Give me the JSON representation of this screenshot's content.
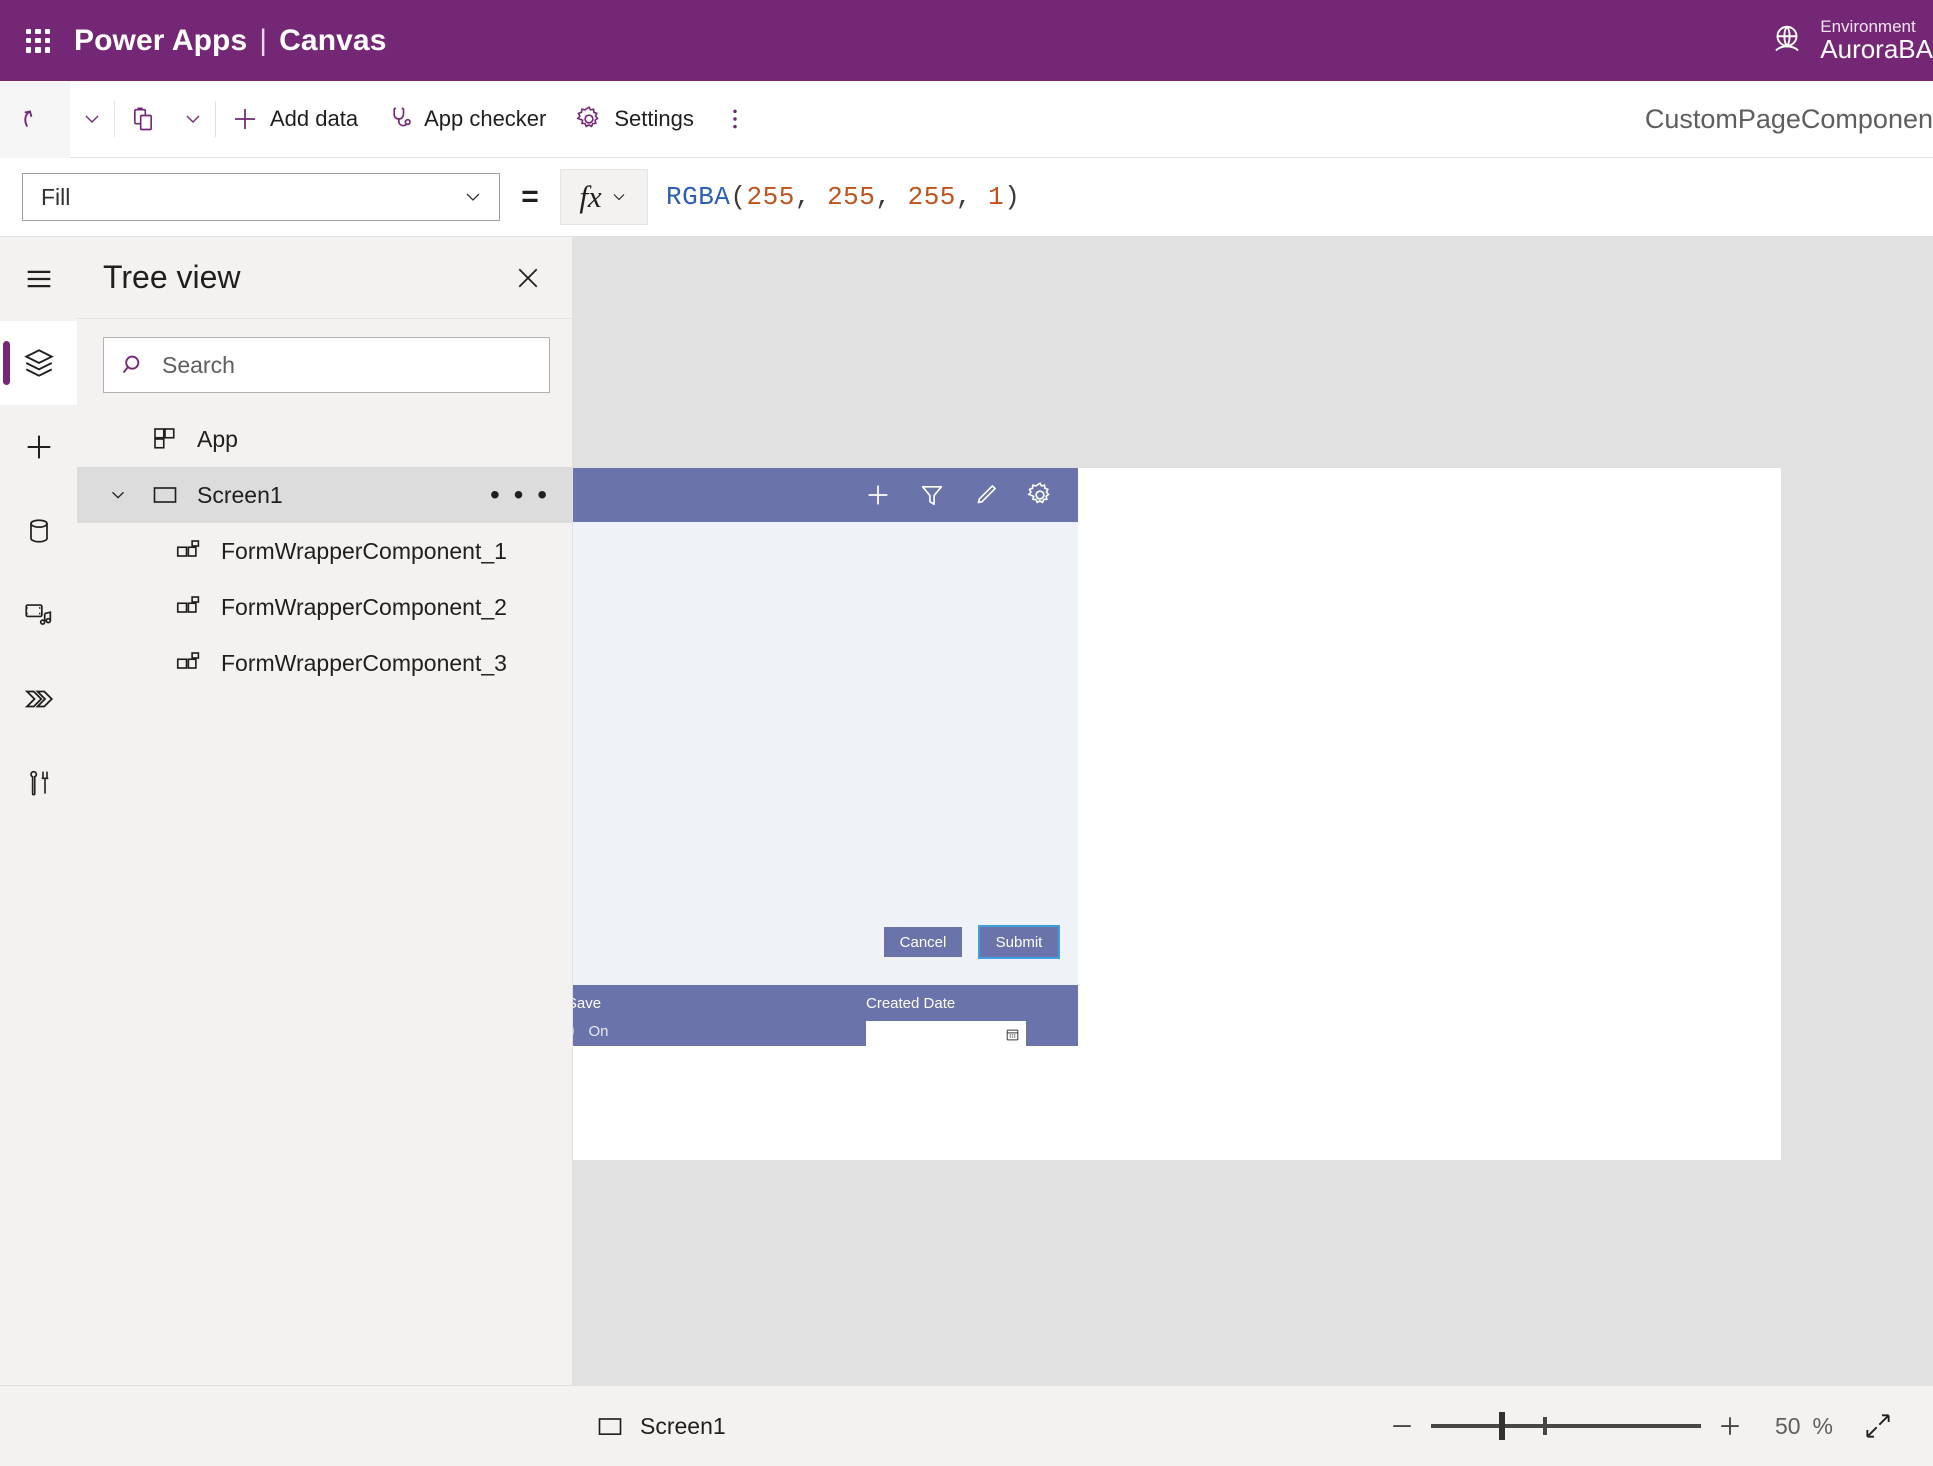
{
  "suite": {
    "waffle_icon": "app-launcher-icon",
    "product": "Power Apps",
    "separator": "|",
    "section": "Canvas",
    "environment_label": "Environment",
    "environment_name": "AuroraBA",
    "globe_icon": "globe-environment-icon",
    "brand_color": "#742774"
  },
  "toolbar": {
    "undo_icon": "undo-icon",
    "undo_chevron_icon": "chevron-down-icon",
    "paste_icon": "clipboard-paste-icon",
    "paste_chevron_icon": "chevron-down-icon",
    "add_data_icon": "plus-icon",
    "add_data_label": "Add data",
    "app_checker_icon": "stethoscope-icon",
    "app_checker_label": "App checker",
    "settings_icon": "gear-icon",
    "settings_label": "Settings",
    "overflow_icon": "more-vertical-icon",
    "app_name": "CustomPageComponen"
  },
  "formula_bar": {
    "property": "Fill",
    "property_chevron_icon": "chevron-down-icon",
    "equals": "=",
    "fx_glyph": "fx",
    "fx_chevron_icon": "chevron-down-icon",
    "formula_tokens": [
      {
        "text": "RGBA",
        "type": "fn"
      },
      {
        "text": "(",
        "type": "punc"
      },
      {
        "text": "255",
        "type": "num"
      },
      {
        "text": ", ",
        "type": "punc"
      },
      {
        "text": "255",
        "type": "num"
      },
      {
        "text": ", ",
        "type": "punc"
      },
      {
        "text": "255",
        "type": "num"
      },
      {
        "text": ", ",
        "type": "punc"
      },
      {
        "text": "1",
        "type": "num"
      },
      {
        "text": ")",
        "type": "punc"
      }
    ],
    "formula_text": "RGBA(255, 255, 255, 1)"
  },
  "rail": {
    "items": [
      {
        "name": "hamburger-menu-icon",
        "active": false
      },
      {
        "name": "tree-view-layers-icon",
        "active": true
      },
      {
        "name": "insert-plus-icon",
        "active": false
      },
      {
        "name": "data-database-icon",
        "active": false
      },
      {
        "name": "media-icon",
        "active": false
      },
      {
        "name": "power-automate-icon",
        "active": false
      },
      {
        "name": "advanced-tools-icon",
        "active": false
      }
    ]
  },
  "tree_view": {
    "title": "Tree view",
    "close_icon": "close-icon",
    "search_icon": "search-icon",
    "search_value": "",
    "search_placeholder": "Search",
    "rows": [
      {
        "label": "App",
        "icon": "app-component-icon",
        "level": 1,
        "selected": false,
        "twisty": "",
        "menu": ""
      },
      {
        "label": "Screen1",
        "icon": "screen-rectangle-icon",
        "level": 1,
        "selected": true,
        "twisty": "chevron-down-icon",
        "menu": "more-horizontal-icon"
      },
      {
        "label": "FormWrapperComponent_1",
        "icon": "component-icon",
        "level": 2,
        "selected": false,
        "twisty": "",
        "menu": ""
      },
      {
        "label": "FormWrapperComponent_2",
        "icon": "component-icon",
        "level": 2,
        "selected": false,
        "twisty": "",
        "menu": ""
      },
      {
        "label": "FormWrapperComponent_3",
        "icon": "component-icon",
        "level": 2,
        "selected": false,
        "twisty": "",
        "menu": ""
      }
    ]
  },
  "canvas": {
    "screen_fill": "#ffffff",
    "component": {
      "header_color": "#6a74ab",
      "body_color": "#eff2f7",
      "back_icon": "back-arrow-circle-icon",
      "header_icons": [
        {
          "name": "plus-icon"
        },
        {
          "name": "filter-funnel-icon"
        },
        {
          "name": "edit-pencil-icon"
        },
        {
          "name": "gear-icon"
        }
      ],
      "cancel_label": "Cancel",
      "submit_label": "Submit",
      "autosave_label": "AutoSave",
      "autosave_state": "On",
      "created_date_label": "Created Date",
      "created_date_value": "",
      "calendar_icon": "calendar-icon"
    }
  },
  "status_bar": {
    "screen_icon": "screen-rectangle-icon",
    "screen_name": "Screen1",
    "zoom_out_icon": "minus-icon",
    "zoom_in_icon": "plus-icon",
    "zoom_value": "50",
    "zoom_unit": "%",
    "fit_icon": "fit-to-screen-icon"
  }
}
